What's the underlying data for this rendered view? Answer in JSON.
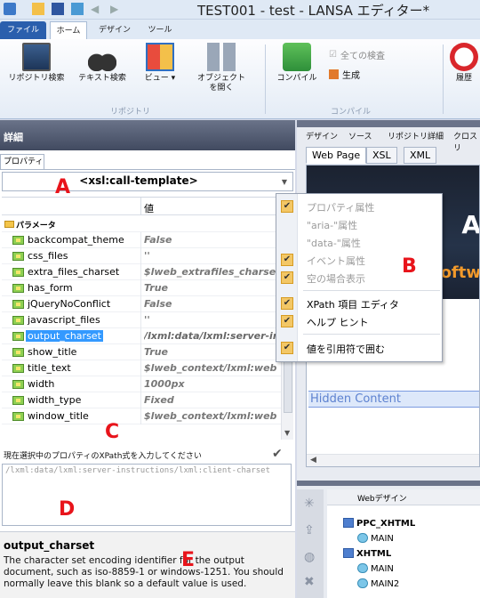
{
  "window": {
    "title": "TEST001 - test - LANSA エディター*"
  },
  "ribbon_tabs": [
    "ファイル",
    "ホーム",
    "デザイン",
    "ツール"
  ],
  "ribbon": {
    "repo_browse": "リポジトリ検索",
    "text_search": "テキスト検索",
    "view": "ビュー",
    "open_object_line1": "オブジェクト",
    "open_object_line2": "を開く",
    "group_repository": "リポジトリ",
    "all_checks": "全ての検査",
    "generate": "生成",
    "compile": "コンパイル",
    "group_compile": "コンパイル",
    "history": "履歴"
  },
  "panel": {
    "header": "詳細",
    "prop_tab": "プロパティ",
    "combo_value": "<xsl:call-template>",
    "col_value": "値",
    "param_group": "パラメータ"
  },
  "properties": [
    {
      "name": "backcompat_theme",
      "value": "False"
    },
    {
      "name": "css_files",
      "value": "''"
    },
    {
      "name": "extra_files_charset",
      "value": "$lweb_extrafiles_charset"
    },
    {
      "name": "has_form",
      "value": "True"
    },
    {
      "name": "jQueryNoConflict",
      "value": "False"
    },
    {
      "name": "javascript_files",
      "value": "''"
    },
    {
      "name": "output_charset",
      "value": "/lxml:data/lxml:server-in"
    },
    {
      "name": "show_title",
      "value": "True"
    },
    {
      "name": "title_text",
      "value": "$lweb_context/lxml:web"
    },
    {
      "name": "width",
      "value": "1000px"
    },
    {
      "name": "width_type",
      "value": "Fixed"
    },
    {
      "name": "window_title",
      "value": "$lweb_context/lxml:web"
    }
  ],
  "xpath": {
    "label": "現在選択中のプロパティのXPath式を入力してください",
    "value": "/lxml:data/lxml:server-instructions/lxml:client-charset"
  },
  "description": {
    "title": "output_charset",
    "text": "The character set encoding identifier for the output document, such as iso-8859-1 or windows-1251. You should normally leave this blank so a default value is used."
  },
  "annotations": [
    "A",
    "B",
    "C",
    "D",
    "E"
  ],
  "context_menu": [
    {
      "label": "プロパティ属性",
      "checked": true,
      "disabled": true
    },
    {
      "label": "\"aria-\"属性",
      "checked": false,
      "disabled": true
    },
    {
      "label": "\"data-\"属性",
      "checked": false,
      "disabled": true
    },
    {
      "label": "イベント属性",
      "checked": true,
      "disabled": true
    },
    {
      "label": "空の場合表示",
      "checked": true,
      "disabled": true
    },
    {
      "label": "XPath 項目 エディタ",
      "checked": true,
      "disabled": false
    },
    {
      "label": "ヘルプ ヒント",
      "checked": true,
      "disabled": false
    },
    {
      "label": "値を引用符で囲む",
      "checked": true,
      "disabled": false
    }
  ],
  "right_tabs": [
    "デザイン",
    "ソース",
    "リポジトリ詳細",
    "クロス リ"
  ],
  "design_tabs": [
    "Web Page",
    "XSL",
    "XML"
  ],
  "preview": {
    "banner_text": "A",
    "banner_text2": "oftw",
    "hidden_content": "Hidden Content"
  },
  "web_design": {
    "header": "Webデザイン",
    "nodes": [
      {
        "label": "PPC_XHTML",
        "level": 0
      },
      {
        "label": "MAIN",
        "level": 1
      },
      {
        "label": "XHTML",
        "level": 0
      },
      {
        "label": "MAIN",
        "level": 1
      },
      {
        "label": "MAIN2",
        "level": 1
      }
    ]
  },
  "colors": {
    "accent": "#2a5fad",
    "annotation": "#e8141b",
    "selection": "#3399ff",
    "menu_check": "#f3c766"
  }
}
